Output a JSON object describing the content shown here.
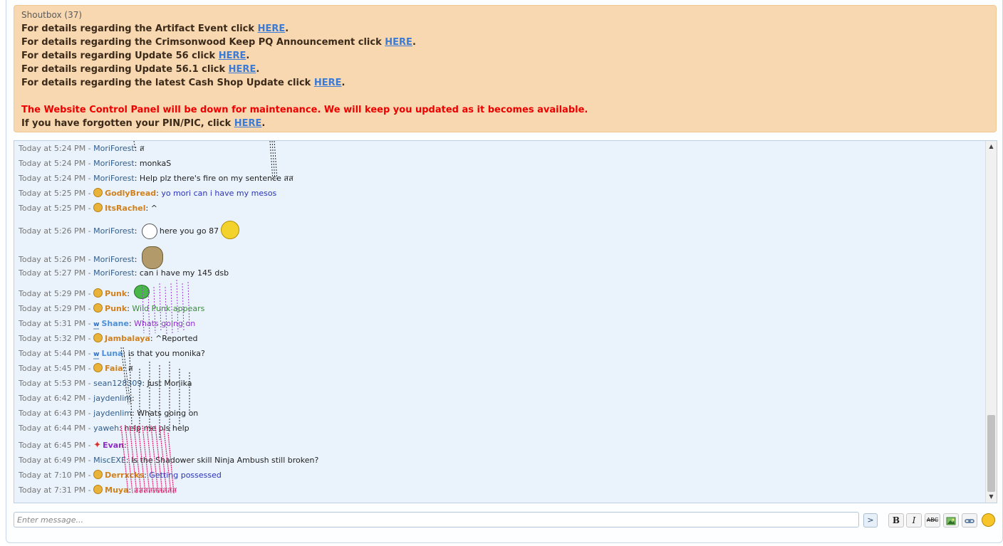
{
  "shoutbox": {
    "title": "Shoutbox (37)",
    "notices": [
      {
        "text": "For details regarding the Artifact Event click ",
        "link": "HERE",
        "end": "."
      },
      {
        "text": "For details regarding the Crimsonwood Keep PQ Announcement click ",
        "link": "HERE",
        "end": "."
      },
      {
        "text": "For details regarding Update 56 click ",
        "link": "HERE",
        "end": "."
      },
      {
        "text": "For details regarding Update 56.1 click ",
        "link": "HERE",
        "end": "."
      },
      {
        "text": "For details regarding the latest Cash Shop Update click ",
        "link": "HERE",
        "end": "."
      }
    ],
    "maintenance": "The Website Control Panel will be down for maintenance. We will keep you updated as it becomes available.",
    "pin_text": "If you have forgotten your PIN/PIC, click ",
    "pin_link": "HERE",
    "pin_end": "."
  },
  "messages": [
    {
      "time": "Today at 5:24 PM",
      "user": "MoriForest",
      "text": "ส"
    },
    {
      "time": "Today at 5:24 PM",
      "user": "MoriForest",
      "text": "monkaS"
    },
    {
      "time": "Today at 5:24 PM",
      "user": "MoriForest",
      "text": "Help plz there's fire on my sentence สส"
    },
    {
      "time": "Today at 5:25 PM",
      "user": "GodlyBread",
      "text": "yo mori can i have my mesos"
    },
    {
      "time": "Today at 5:25 PM",
      "user": "ItsRachel",
      "text": "^"
    },
    {
      "time": "Today at 5:26 PM",
      "user": "MoriForest",
      "text": "here you go 87"
    },
    {
      "time": "Today at 5:26 PM",
      "user": "MoriForest",
      "text": ""
    },
    {
      "time": "Today at 5:27 PM",
      "user": "MoriForest",
      "text": "can i have my 145 dsb"
    },
    {
      "time": "Today at 5:29 PM",
      "user": "Punk",
      "text": ""
    },
    {
      "time": "Today at 5:29 PM",
      "user": "Punk",
      "text": "Wild Punk appears"
    },
    {
      "time": "Today at 5:31 PM",
      "user": "Shane",
      "text": "Whats going on"
    },
    {
      "time": "Today at 5:32 PM",
      "user": "Jambalaya",
      "text": "^Reported"
    },
    {
      "time": "Today at 5:44 PM",
      "user": "Luna",
      "text": "is that you monika?"
    },
    {
      "time": "Today at 5:45 PM",
      "user": "Faia",
      "text": "ส"
    },
    {
      "time": "Today at 5:53 PM",
      "user": "sean128309",
      "text": "Just Monika"
    },
    {
      "time": "Today at 6:42 PM",
      "user": "jaydenlim",
      "text": ""
    },
    {
      "time": "Today at 6:43 PM",
      "user": "jaydenlim",
      "text": "Whats going on"
    },
    {
      "time": "Today at 6:44 PM",
      "user": "yaweh",
      "text": "help me pls help"
    },
    {
      "time": "Today at 6:45 PM",
      "user": "Evan",
      "text": ""
    },
    {
      "time": "Today at 6:49 PM",
      "user": "MiscEXE",
      "text": "Is the Shadower skill Ninja Ambush still broken?"
    },
    {
      "time": "Today at 7:10 PM",
      "user": "Derrxcks",
      "text": "Getting possessed"
    },
    {
      "time": "Today at 7:31 PM",
      "user": "Muya",
      "text": "สสสสสสสสส"
    }
  ],
  "composer": {
    "placeholder": "Enter message...",
    "send_label": ">",
    "bold_label": "B",
    "italic_label": "I",
    "strike_label": "ABC"
  },
  "icons": {
    "send": "send-icon",
    "bold": "bold-icon",
    "italic": "italic-icon",
    "strike": "strikethrough-icon",
    "image": "image-icon",
    "link": "link-icon",
    "smiley": "smiley-icon"
  },
  "colors": {
    "notice_bg": "#f8d8b0",
    "chat_bg": "#eaf3fb",
    "link": "#3b7bd6",
    "alert_red": "#ee0000"
  }
}
